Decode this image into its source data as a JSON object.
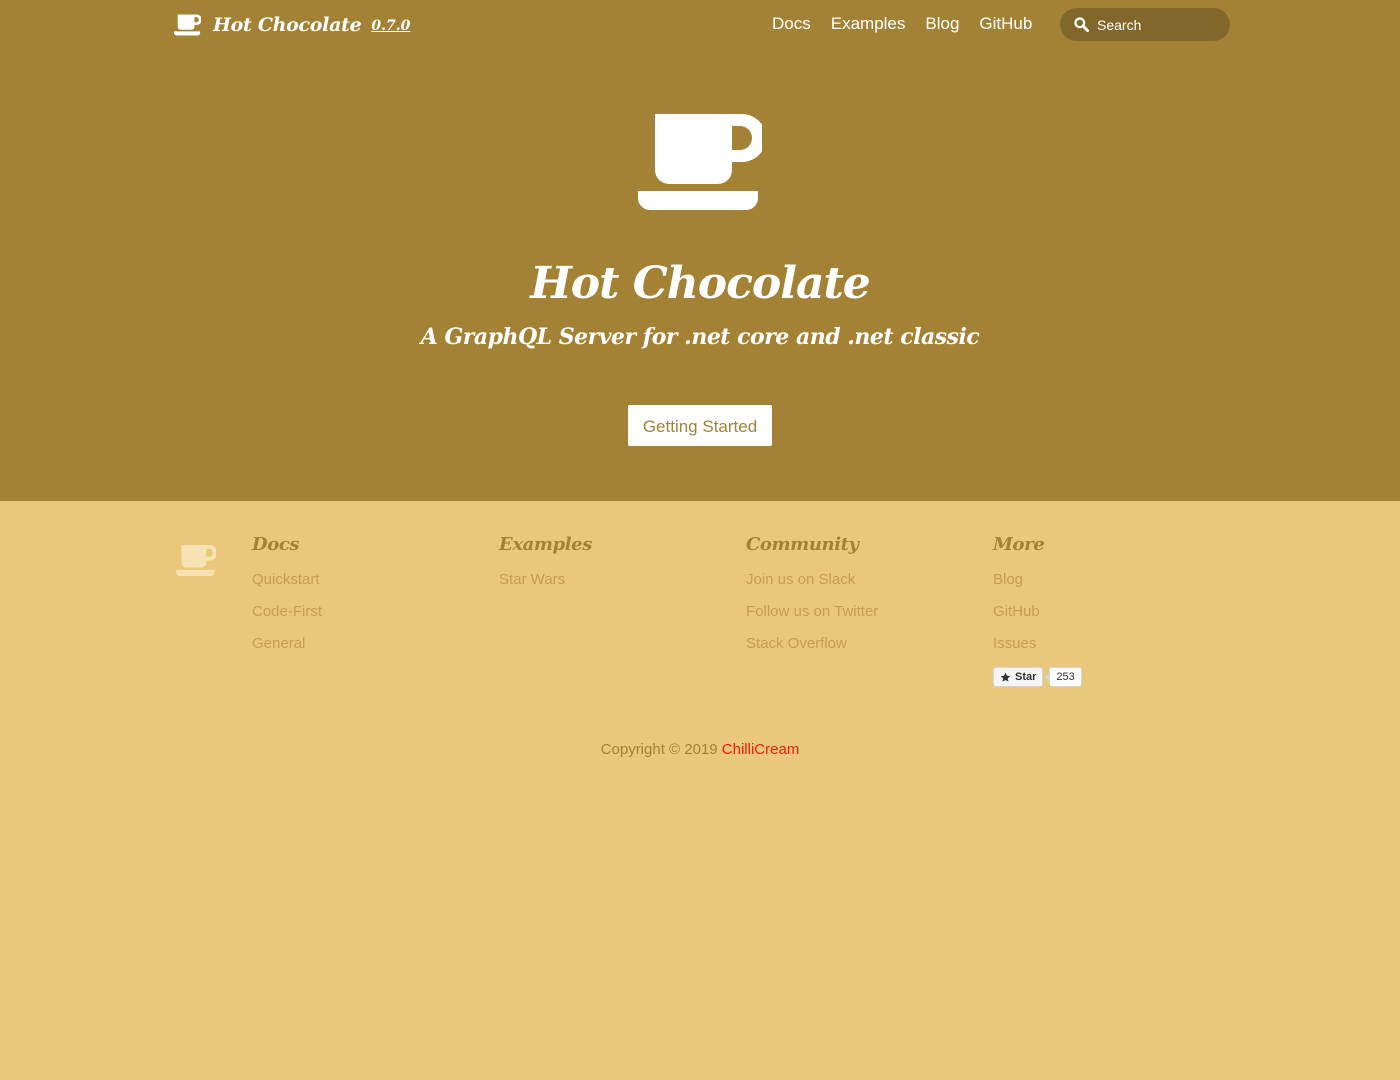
{
  "header": {
    "brand_title": "Hot Chocolate",
    "version": "0.7.0",
    "nav": [
      "Docs",
      "Examples",
      "Blog",
      "GitHub"
    ],
    "search_placeholder": "Search",
    "logo_icon": "coffee-cup-icon"
  },
  "hero": {
    "icon": "coffee-cup-icon",
    "title": "Hot Chocolate",
    "tagline": "A GraphQL Server for .net core and .net classic",
    "cta_label": "Getting Started"
  },
  "footer": {
    "logo_icon": "coffee-cup-icon",
    "columns": [
      {
        "heading": "Docs",
        "links": [
          "Quickstart",
          "Code-First",
          "General"
        ]
      },
      {
        "heading": "Examples",
        "links": [
          "Star Wars"
        ]
      },
      {
        "heading": "Community",
        "links": [
          "Join us on Slack",
          "Follow us on Twitter",
          "Stack Overflow"
        ]
      },
      {
        "heading": "More",
        "links": [
          "Blog",
          "GitHub",
          "Issues"
        ]
      }
    ],
    "github_star": {
      "label": "Star",
      "count": "253",
      "icon": "star-icon"
    },
    "copyright_text": "Copyright © 2019",
    "copyright_owner": "ChilliCream"
  },
  "colors": {
    "header_bg": "#a38236",
    "footer_bg": "#ebc77b",
    "search_bg": "#82672a",
    "footer_link": "#c39e55",
    "accent_red": "#e8210b"
  }
}
